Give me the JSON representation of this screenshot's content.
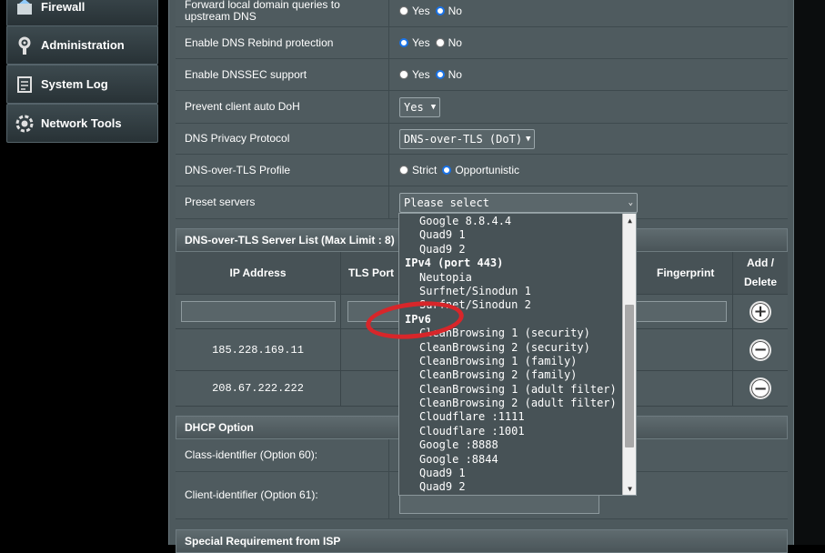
{
  "sidebar": {
    "items": [
      {
        "label": "Firewall",
        "icon": "firewall-icon"
      },
      {
        "label": "Administration",
        "icon": "administration-gear-icon"
      },
      {
        "label": "System Log",
        "icon": "system-log-icon"
      },
      {
        "label": "Network Tools",
        "icon": "network-tools-icon"
      }
    ]
  },
  "settings": {
    "forward_local": {
      "label": "Forward local domain queries to upstream DNS",
      "yes": "Yes",
      "no": "No",
      "selected": "No"
    },
    "dns_rebind": {
      "label": "Enable DNS Rebind protection",
      "yes": "Yes",
      "no": "No",
      "selected": "Yes"
    },
    "dnssec": {
      "label": "Enable DNSSEC support",
      "yes": "Yes",
      "no": "No",
      "selected": "No"
    },
    "prevent_doh": {
      "label": "Prevent client auto DoH",
      "value": "Yes"
    },
    "privacy_protocol": {
      "label": "DNS Privacy Protocol",
      "value": "DNS-over-TLS (DoT)"
    },
    "dot_profile": {
      "label": "DNS-over-TLS Profile",
      "strict": "Strict",
      "opportunistic": "Opportunistic",
      "selected": "Opportunistic"
    },
    "preset_servers": {
      "label": "Preset servers",
      "value": "Please select"
    }
  },
  "dot_list": {
    "title": "DNS-over-TLS Server List (Max Limit : 8)",
    "columns": {
      "ip": "IP Address",
      "port": "TLS Port",
      "fingerprint": "Fingerprint",
      "add_delete": "Add / Delete"
    },
    "rows": [
      {
        "ip": "185.228.169.11"
      },
      {
        "ip": "208.67.222.222"
      }
    ]
  },
  "dhcp": {
    "title": "DHCP Option",
    "class_id": "Class-identifier (Option 60):",
    "client_id": "Client-identifier (Option 61):"
  },
  "special": {
    "title": "Special Requirement from ISP"
  },
  "dropdown": {
    "entries": [
      {
        "type": "item",
        "text": "Google 8.8.4.4"
      },
      {
        "type": "item",
        "text": "Quad9 1"
      },
      {
        "type": "item",
        "text": "Quad9 2"
      },
      {
        "type": "group",
        "text": "IPv4 (port 443)"
      },
      {
        "type": "item",
        "text": "Neutopia"
      },
      {
        "type": "item",
        "text": "Surfnet/Sinodun 1"
      },
      {
        "type": "item",
        "text": "Surfnet/Sinodun 2"
      },
      {
        "type": "group",
        "text": "IPv6"
      },
      {
        "type": "item",
        "text": "CleanBrowsing 1 (security)"
      },
      {
        "type": "item",
        "text": "CleanBrowsing 2 (security)"
      },
      {
        "type": "item",
        "text": "CleanBrowsing 1 (family)"
      },
      {
        "type": "item",
        "text": "CleanBrowsing 2 (family)"
      },
      {
        "type": "item",
        "text": "CleanBrowsing 1 (adult filter)"
      },
      {
        "type": "item",
        "text": "CleanBrowsing 2 (adult filter)"
      },
      {
        "type": "item",
        "text": "Cloudflare :1111"
      },
      {
        "type": "item",
        "text": "Cloudflare :1001"
      },
      {
        "type": "item",
        "text": "Google :8888"
      },
      {
        "type": "item",
        "text": "Google :8844"
      },
      {
        "type": "item",
        "text": "Quad9 1"
      },
      {
        "type": "item",
        "text": "Quad9 2"
      }
    ]
  },
  "colors": {
    "panel": "#4d595d",
    "annotation": "#d8262a",
    "radio_on": "#1a73e8"
  }
}
